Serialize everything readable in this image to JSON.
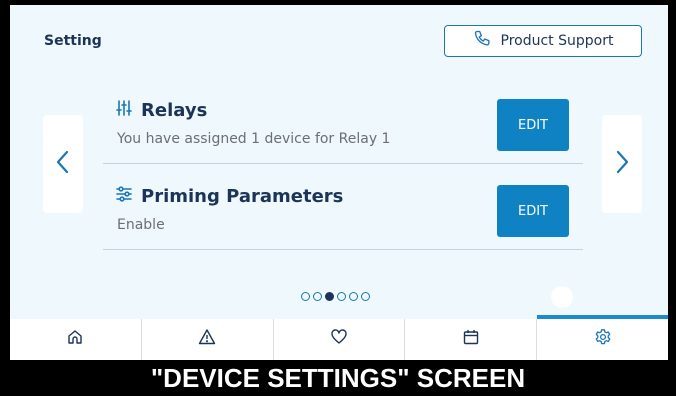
{
  "screen_title": "Setting",
  "support_button": {
    "label": "Product Support",
    "icon": "phone-icon"
  },
  "cards": [
    {
      "title": "Relays",
      "subtitle": "You have assigned 1 device for Relay 1",
      "button": "EDIT",
      "icon": "sliders-vertical-icon"
    },
    {
      "title": "Priming Parameters",
      "subtitle": "Enable",
      "button": "EDIT",
      "icon": "sliders-horizontal-icon"
    }
  ],
  "pagination": {
    "count": 6,
    "active_index": 2
  },
  "tabs": [
    {
      "icon": "home-icon"
    },
    {
      "icon": "alert-icon"
    },
    {
      "icon": "heart-icon"
    },
    {
      "icon": "calendar-icon"
    },
    {
      "icon": "gear-icon",
      "active": true
    }
  ],
  "caption": "\"DEVICE SETTINGS\" SCREEN",
  "colors": {
    "background": "#eef8fd",
    "navy": "#1c3458",
    "accent": "#0f82c3",
    "frame": "#000000"
  }
}
